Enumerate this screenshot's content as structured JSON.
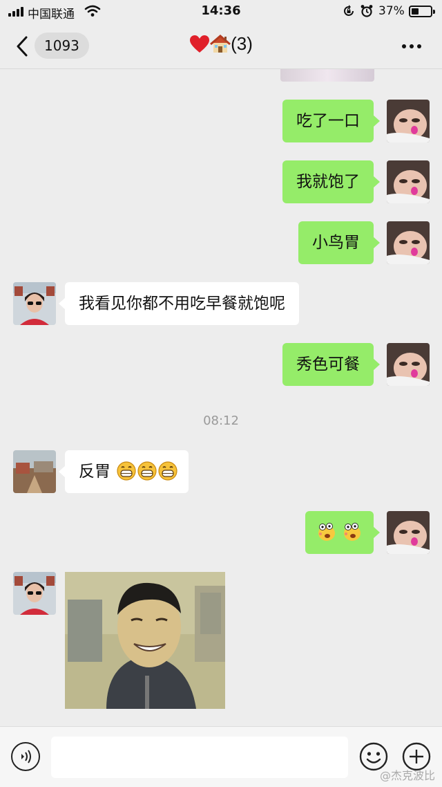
{
  "status_bar": {
    "carrier": "中国联通",
    "time": "14:36",
    "battery_percent": "37%",
    "battery_level": 0.37
  },
  "nav": {
    "unread_count": "1093",
    "title_emojis": [
      "heart-icon",
      "house-icon"
    ],
    "title_count": "(3)"
  },
  "chat": {
    "messages": [
      {
        "sender": "me",
        "text": "吃了一口"
      },
      {
        "sender": "me",
        "text": "我就饱了"
      },
      {
        "sender": "me",
        "text": "小鸟胃"
      },
      {
        "sender": "other",
        "text": "我看见你都不用吃早餐就饱呢"
      },
      {
        "sender": "me",
        "text": "秀色可餐"
      },
      {
        "sender": "other",
        "text": "反胃",
        "emojis": [
          "grin-emoji",
          "grin-emoji",
          "grin-emoji"
        ]
      },
      {
        "sender": "me",
        "text": "",
        "emojis": [
          "dizzy-face-emoji",
          "dizzy-face-emoji"
        ]
      },
      {
        "sender": "other",
        "text": "",
        "image": "grinning-man-photo"
      }
    ],
    "timestamp": "08:12"
  },
  "watermark": "@杰克波比",
  "colors": {
    "background": "#ededed",
    "my_bubble": "#95ec69",
    "other_bubble": "#ffffff",
    "timestamp": "#9a9a9a"
  }
}
